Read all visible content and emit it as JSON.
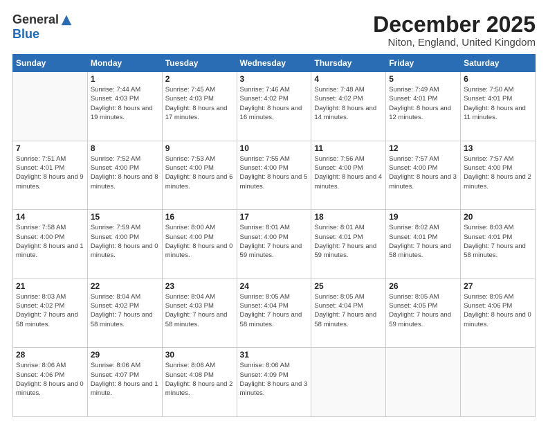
{
  "logo": {
    "general": "General",
    "blue": "Blue"
  },
  "header": {
    "month": "December 2025",
    "location": "Niton, England, United Kingdom"
  },
  "weekdays": [
    "Sunday",
    "Monday",
    "Tuesday",
    "Wednesday",
    "Thursday",
    "Friday",
    "Saturday"
  ],
  "weeks": [
    [
      {
        "num": "",
        "sunrise": "",
        "sunset": "",
        "daylight": ""
      },
      {
        "num": "1",
        "sunrise": "Sunrise: 7:44 AM",
        "sunset": "Sunset: 4:03 PM",
        "daylight": "Daylight: 8 hours and 19 minutes."
      },
      {
        "num": "2",
        "sunrise": "Sunrise: 7:45 AM",
        "sunset": "Sunset: 4:03 PM",
        "daylight": "Daylight: 8 hours and 17 minutes."
      },
      {
        "num": "3",
        "sunrise": "Sunrise: 7:46 AM",
        "sunset": "Sunset: 4:02 PM",
        "daylight": "Daylight: 8 hours and 16 minutes."
      },
      {
        "num": "4",
        "sunrise": "Sunrise: 7:48 AM",
        "sunset": "Sunset: 4:02 PM",
        "daylight": "Daylight: 8 hours and 14 minutes."
      },
      {
        "num": "5",
        "sunrise": "Sunrise: 7:49 AM",
        "sunset": "Sunset: 4:01 PM",
        "daylight": "Daylight: 8 hours and 12 minutes."
      },
      {
        "num": "6",
        "sunrise": "Sunrise: 7:50 AM",
        "sunset": "Sunset: 4:01 PM",
        "daylight": "Daylight: 8 hours and 11 minutes."
      }
    ],
    [
      {
        "num": "7",
        "sunrise": "Sunrise: 7:51 AM",
        "sunset": "Sunset: 4:01 PM",
        "daylight": "Daylight: 8 hours and 9 minutes."
      },
      {
        "num": "8",
        "sunrise": "Sunrise: 7:52 AM",
        "sunset": "Sunset: 4:00 PM",
        "daylight": "Daylight: 8 hours and 8 minutes."
      },
      {
        "num": "9",
        "sunrise": "Sunrise: 7:53 AM",
        "sunset": "Sunset: 4:00 PM",
        "daylight": "Daylight: 8 hours and 6 minutes."
      },
      {
        "num": "10",
        "sunrise": "Sunrise: 7:55 AM",
        "sunset": "Sunset: 4:00 PM",
        "daylight": "Daylight: 8 hours and 5 minutes."
      },
      {
        "num": "11",
        "sunrise": "Sunrise: 7:56 AM",
        "sunset": "Sunset: 4:00 PM",
        "daylight": "Daylight: 8 hours and 4 minutes."
      },
      {
        "num": "12",
        "sunrise": "Sunrise: 7:57 AM",
        "sunset": "Sunset: 4:00 PM",
        "daylight": "Daylight: 8 hours and 3 minutes."
      },
      {
        "num": "13",
        "sunrise": "Sunrise: 7:57 AM",
        "sunset": "Sunset: 4:00 PM",
        "daylight": "Daylight: 8 hours and 2 minutes."
      }
    ],
    [
      {
        "num": "14",
        "sunrise": "Sunrise: 7:58 AM",
        "sunset": "Sunset: 4:00 PM",
        "daylight": "Daylight: 8 hours and 1 minute."
      },
      {
        "num": "15",
        "sunrise": "Sunrise: 7:59 AM",
        "sunset": "Sunset: 4:00 PM",
        "daylight": "Daylight: 8 hours and 0 minutes."
      },
      {
        "num": "16",
        "sunrise": "Sunrise: 8:00 AM",
        "sunset": "Sunset: 4:00 PM",
        "daylight": "Daylight: 8 hours and 0 minutes."
      },
      {
        "num": "17",
        "sunrise": "Sunrise: 8:01 AM",
        "sunset": "Sunset: 4:00 PM",
        "daylight": "Daylight: 7 hours and 59 minutes."
      },
      {
        "num": "18",
        "sunrise": "Sunrise: 8:01 AM",
        "sunset": "Sunset: 4:01 PM",
        "daylight": "Daylight: 7 hours and 59 minutes."
      },
      {
        "num": "19",
        "sunrise": "Sunrise: 8:02 AM",
        "sunset": "Sunset: 4:01 PM",
        "daylight": "Daylight: 7 hours and 58 minutes."
      },
      {
        "num": "20",
        "sunrise": "Sunrise: 8:03 AM",
        "sunset": "Sunset: 4:01 PM",
        "daylight": "Daylight: 7 hours and 58 minutes."
      }
    ],
    [
      {
        "num": "21",
        "sunrise": "Sunrise: 8:03 AM",
        "sunset": "Sunset: 4:02 PM",
        "daylight": "Daylight: 7 hours and 58 minutes."
      },
      {
        "num": "22",
        "sunrise": "Sunrise: 8:04 AM",
        "sunset": "Sunset: 4:02 PM",
        "daylight": "Daylight: 7 hours and 58 minutes."
      },
      {
        "num": "23",
        "sunrise": "Sunrise: 8:04 AM",
        "sunset": "Sunset: 4:03 PM",
        "daylight": "Daylight: 7 hours and 58 minutes."
      },
      {
        "num": "24",
        "sunrise": "Sunrise: 8:05 AM",
        "sunset": "Sunset: 4:04 PM",
        "daylight": "Daylight: 7 hours and 58 minutes."
      },
      {
        "num": "25",
        "sunrise": "Sunrise: 8:05 AM",
        "sunset": "Sunset: 4:04 PM",
        "daylight": "Daylight: 7 hours and 58 minutes."
      },
      {
        "num": "26",
        "sunrise": "Sunrise: 8:05 AM",
        "sunset": "Sunset: 4:05 PM",
        "daylight": "Daylight: 7 hours and 59 minutes."
      },
      {
        "num": "27",
        "sunrise": "Sunrise: 8:05 AM",
        "sunset": "Sunset: 4:06 PM",
        "daylight": "Daylight: 8 hours and 0 minutes."
      }
    ],
    [
      {
        "num": "28",
        "sunrise": "Sunrise: 8:06 AM",
        "sunset": "Sunset: 4:06 PM",
        "daylight": "Daylight: 8 hours and 0 minutes."
      },
      {
        "num": "29",
        "sunrise": "Sunrise: 8:06 AM",
        "sunset": "Sunset: 4:07 PM",
        "daylight": "Daylight: 8 hours and 1 minute."
      },
      {
        "num": "30",
        "sunrise": "Sunrise: 8:06 AM",
        "sunset": "Sunset: 4:08 PM",
        "daylight": "Daylight: 8 hours and 2 minutes."
      },
      {
        "num": "31",
        "sunrise": "Sunrise: 8:06 AM",
        "sunset": "Sunset: 4:09 PM",
        "daylight": "Daylight: 8 hours and 3 minutes."
      },
      {
        "num": "",
        "sunrise": "",
        "sunset": "",
        "daylight": ""
      },
      {
        "num": "",
        "sunrise": "",
        "sunset": "",
        "daylight": ""
      },
      {
        "num": "",
        "sunrise": "",
        "sunset": "",
        "daylight": ""
      }
    ]
  ]
}
